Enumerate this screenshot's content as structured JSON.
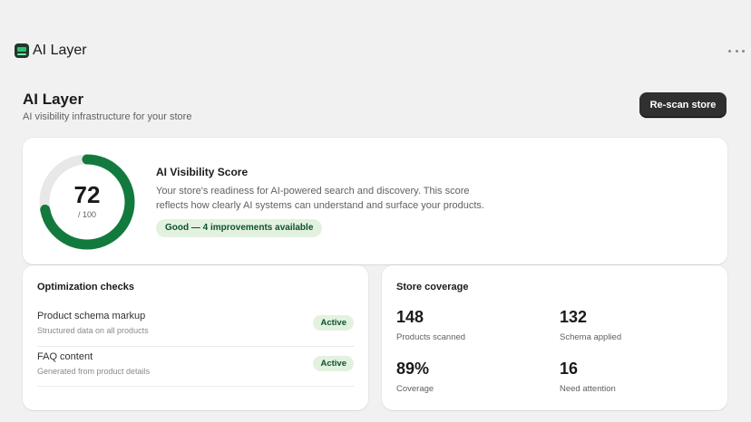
{
  "app": {
    "name": "AI Layer"
  },
  "header": {
    "title": "AI Layer",
    "subtitle": "AI visibility infrastructure for your store",
    "rescan_label": "Re-scan store"
  },
  "score": {
    "value": "72",
    "max_label": "/ 100",
    "fraction": 0.72,
    "title": "AI Visibility Score",
    "description": "Your store's readiness for AI-powered search and discovery. This score reflects how clearly AI systems can understand and surface your products.",
    "badge": "Good — 4 improvements available",
    "ring_color": "#137a3e",
    "track_color": "#e8e8e8"
  },
  "checks": {
    "title": "Optimization checks",
    "items": [
      {
        "name": "Product schema markup",
        "desc": "Structured data on all products",
        "status": "Active"
      },
      {
        "name": "FAQ content",
        "desc": "Generated from product details",
        "status": "Active"
      }
    ]
  },
  "coverage": {
    "title": "Store coverage",
    "stats": [
      {
        "value": "148",
        "label": "Products scanned"
      },
      {
        "value": "132",
        "label": "Schema applied"
      },
      {
        "value": "89%",
        "label": "Coverage"
      },
      {
        "value": "16",
        "label": "Need attention"
      }
    ]
  },
  "colors": {
    "primary_button": "#303030",
    "success_bg": "#e3f1df",
    "success_text": "#0c5132"
  }
}
